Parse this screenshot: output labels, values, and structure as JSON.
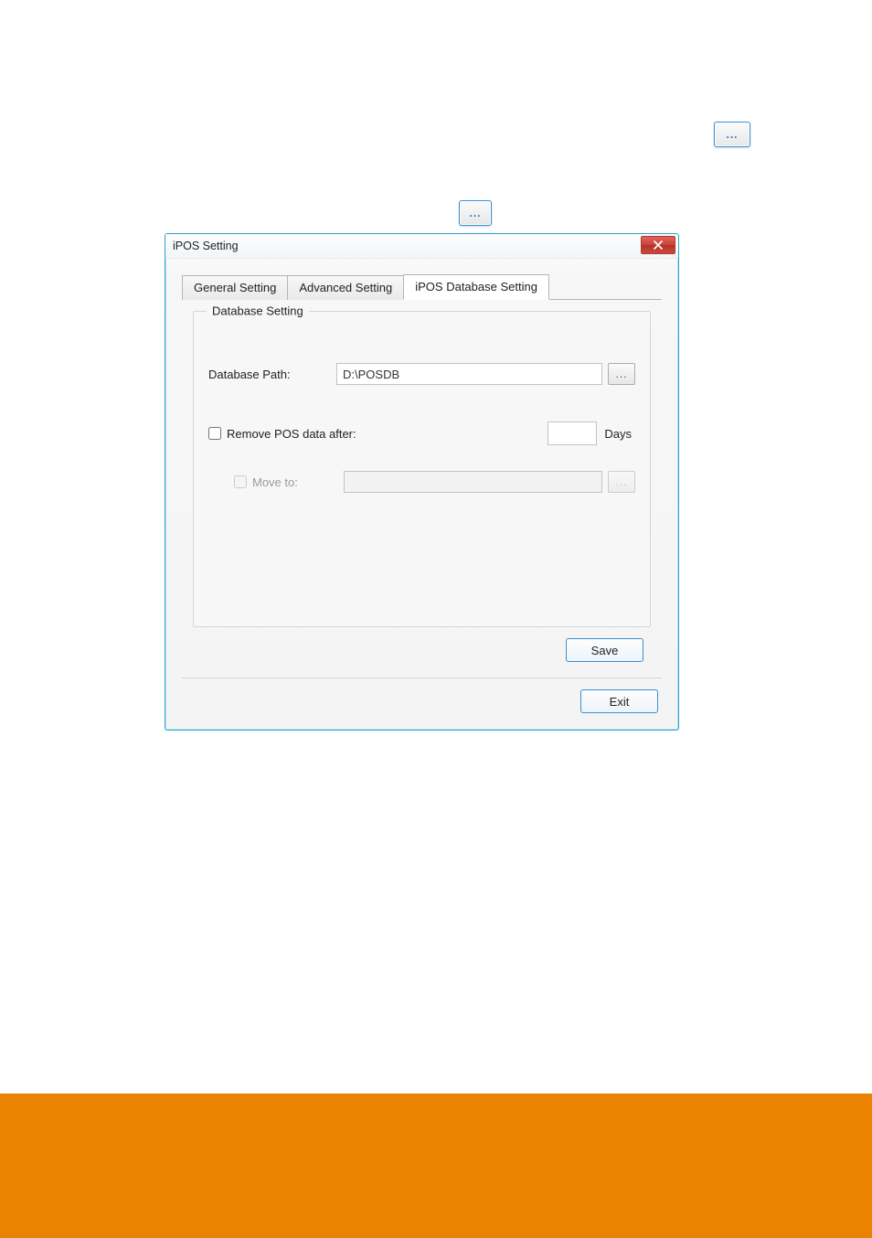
{
  "doc": {
    "browse1_glyph": "...",
    "browse2_glyph": "..."
  },
  "dialog": {
    "title": "iPOS Setting",
    "tabs": {
      "general": "General Setting",
      "advanced": "Advanced Setting",
      "database": "iPOS Database Setting"
    },
    "group_legend": "Database Setting",
    "db_path_label": "Database Path:",
    "db_path_value": "D:\\POSDB",
    "browse_glyph": "...",
    "remove_label": "Remove POS data after:",
    "days_value": "",
    "days_unit": "Days",
    "move_to_label": "Move to:",
    "move_to_value": "",
    "save_label": "Save",
    "exit_label": "Exit"
  }
}
